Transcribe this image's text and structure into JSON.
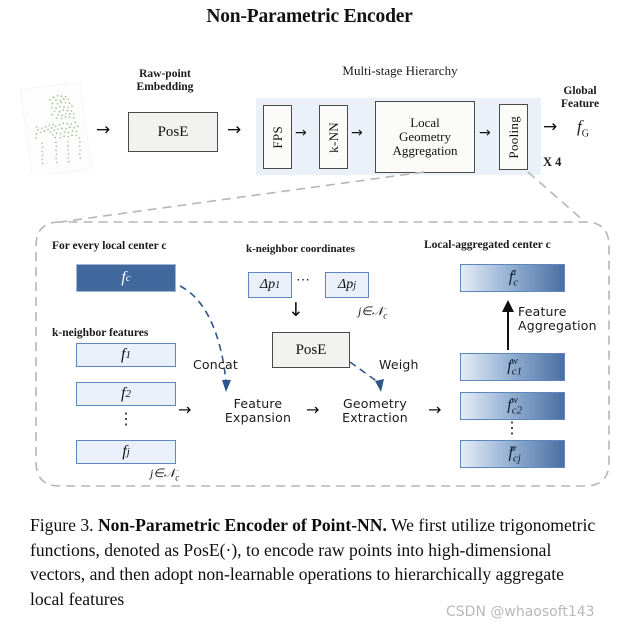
{
  "title": "Non-Parametric Encoder",
  "top_pipeline": {
    "raw_point_label": "Raw-point\nEmbedding",
    "raw_point_label_l1": "Raw-point",
    "raw_point_label_l2": "Embedding",
    "hierarchy_label": "Multi-stage Hierarchy",
    "global_label_l1": "Global",
    "global_label_l2": "Feature",
    "pose_box": "PosE",
    "fps_box": "FPS",
    "knn_box": "k-NN",
    "lga_box_l1": "Local",
    "lga_box_l2": "Geometry",
    "lga_box_l3": "Aggregation",
    "pooling_box": "Pooling",
    "global_feature_symbol": "f",
    "global_feature_sub": "G",
    "repeat_label": "X 4",
    "point_cloud_name": "chair-point-cloud",
    "point_cloud_color": "#9dc08b",
    "hierarchy_bg_color": "#eaf1f8"
  },
  "detail_panel": {
    "left_header": "For every local center c",
    "knf_header": "k-neighbor features",
    "coords_header": "k-neighbor coordinates",
    "right_header": "Local-aggregated center c",
    "center_feature": "fₑ",
    "center_feature_base": "f",
    "center_feature_sub": "c",
    "neighbor_features": [
      {
        "base": "f",
        "sub": "1"
      },
      {
        "base": "f",
        "sub": "2"
      },
      {
        "base": "f",
        "sub": "j"
      }
    ],
    "neighbor_vertical_dots": "⋮",
    "coord_boxes": [
      {
        "label": "Δp",
        "sub": "1"
      },
      {
        "label": "Δp",
        "sub": "j"
      }
    ],
    "coord_h_dots": "⋯",
    "pose_box": "PosE",
    "index_set_mid": "j∈𝒩",
    "index_set_mid_sub": "c",
    "index_set_bottom": "j∈𝒩",
    "index_set_bottom_sub": "c",
    "aggregated": {
      "base": "f",
      "sub": "c",
      "sup": "a"
    },
    "weighted": [
      {
        "base": "f",
        "sub": "c1",
        "sup": "w"
      },
      {
        "base": "f",
        "sub": "c2",
        "sup": "w"
      },
      {
        "base": "f",
        "sub": "cj",
        "sup": "w"
      }
    ],
    "weighted_vertical_dots": "⋮",
    "op_concat": "Concat",
    "op_weigh": "Weigh",
    "op_feature_expansion_l1": "Feature",
    "op_feature_expansion_l2": "Expansion",
    "op_geometry_extraction_l1": "Geometry",
    "op_geometry_extraction_l2": "Extraction",
    "op_feature_aggregation_l1": "Feature",
    "op_feature_aggregation_l2": "Aggregation",
    "arrow_glyph": "→",
    "down_arrow_glyph": "↓",
    "colors": {
      "center_fill": "#41699e",
      "light_fill": "#e9f0f9",
      "box_border": "#5f86bd",
      "gradient_from": "#e4edf7",
      "gradient_to": "#4a6fa3"
    }
  },
  "caption": {
    "prefix": "Figure 3. ",
    "bold": "Non-Parametric Encoder of Point-NN.",
    "rest": " We first utilize trigonometric functions, denoted as PosE(·), to encode raw points into high-dimensional vectors, and then adopt non-learnable operations to hierarchically aggregate local features",
    "watermark": "CSDN @whaosoft143"
  }
}
